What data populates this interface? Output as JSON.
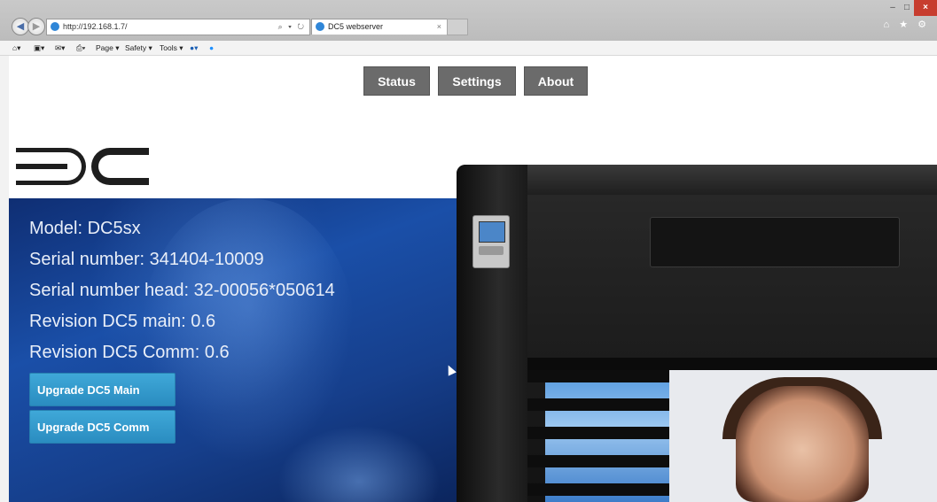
{
  "browser": {
    "url": "http://192.168.1.7/",
    "tab_title": "DC5 webserver",
    "tab_close": "×",
    "address_icons": "⌕ ▾ ↻",
    "window_controls": {
      "minimize": "–",
      "maximize": "□",
      "close": "×"
    },
    "right_icons": "⌂ ★ ⚙",
    "command_bar": {
      "page": "Page ▾",
      "safety": "Safety ▾",
      "tools": "Tools ▾"
    }
  },
  "nav": {
    "status": "Status",
    "settings": "Settings",
    "about": "About"
  },
  "device": {
    "model": "Model: DC5sx",
    "serial": "Serial number: 341404-10009",
    "serial_head": "Serial number head: 32-00056*050614",
    "rev_main": "Revision DC5 main: 0.6",
    "rev_comm": "Revision DC5 Comm: 0.6"
  },
  "actions": {
    "upgrade_main": "Upgrade DC5 Main",
    "upgrade_comm": "Upgrade DC5 Comm"
  },
  "colors": {
    "nav_button": "#6b6b6b",
    "upgrade_button": "#3fa8d8",
    "panel_blue": "#1a4fa8"
  }
}
